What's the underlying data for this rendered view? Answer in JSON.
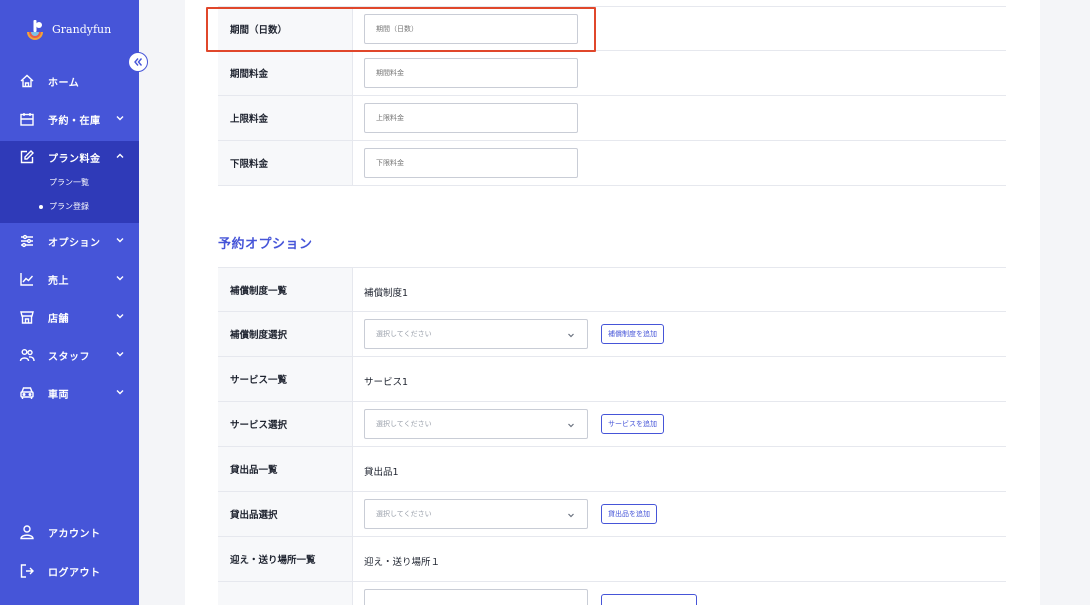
{
  "brand": {
    "name": "Grandyfun"
  },
  "sidebar": {
    "items": [
      {
        "label": "ホーム",
        "icon": "home-icon"
      },
      {
        "label": "予約・在庫",
        "icon": "calendar-icon"
      },
      {
        "label": "プラン料金",
        "icon": "edit-icon"
      },
      {
        "label": "オプション",
        "icon": "options-icon"
      },
      {
        "label": "売上",
        "icon": "chart-icon"
      },
      {
        "label": "店舗",
        "icon": "store-icon"
      },
      {
        "label": "スタッフ",
        "icon": "staff-icon"
      },
      {
        "label": "車両",
        "icon": "car-icon"
      }
    ],
    "subitems": [
      {
        "label": "プラン一覧"
      },
      {
        "label": "プラン登録"
      }
    ],
    "account": "アカウント",
    "logout": "ログアウト"
  },
  "form": {
    "period_days": {
      "label": "期間（日数）",
      "placeholder": "期間（日数）"
    },
    "period_fee": {
      "label": "期間料金",
      "placeholder": "期間料金"
    },
    "max_fee": {
      "label": "上限料金",
      "placeholder": "上限料金"
    },
    "min_fee": {
      "label": "下限料金",
      "placeholder": "下限料金"
    }
  },
  "options_section": {
    "title": "予約オプション",
    "compensation_list": {
      "label": "補償制度一覧",
      "value": "補償制度1"
    },
    "compensation_select": {
      "label": "補償制度選択",
      "placeholder": "選択してください",
      "button": "補償制度を追加"
    },
    "service_list": {
      "label": "サービス一覧",
      "value": "サービス1"
    },
    "service_select": {
      "label": "サービス選択",
      "placeholder": "選択してください",
      "button": "サービスを追加"
    },
    "rental_list": {
      "label": "貸出品一覧",
      "value": "貸出品1"
    },
    "rental_select": {
      "label": "貸出品選択",
      "placeholder": "選択してください",
      "button": "貸出品を追加"
    },
    "pickup_list": {
      "label": "迎え・送り場所一覧",
      "value": "迎え・送り場所１"
    }
  },
  "colors": {
    "primary": "#4655d8",
    "sidebar_active": "#2f3ab8",
    "highlight": "#e0472b"
  }
}
